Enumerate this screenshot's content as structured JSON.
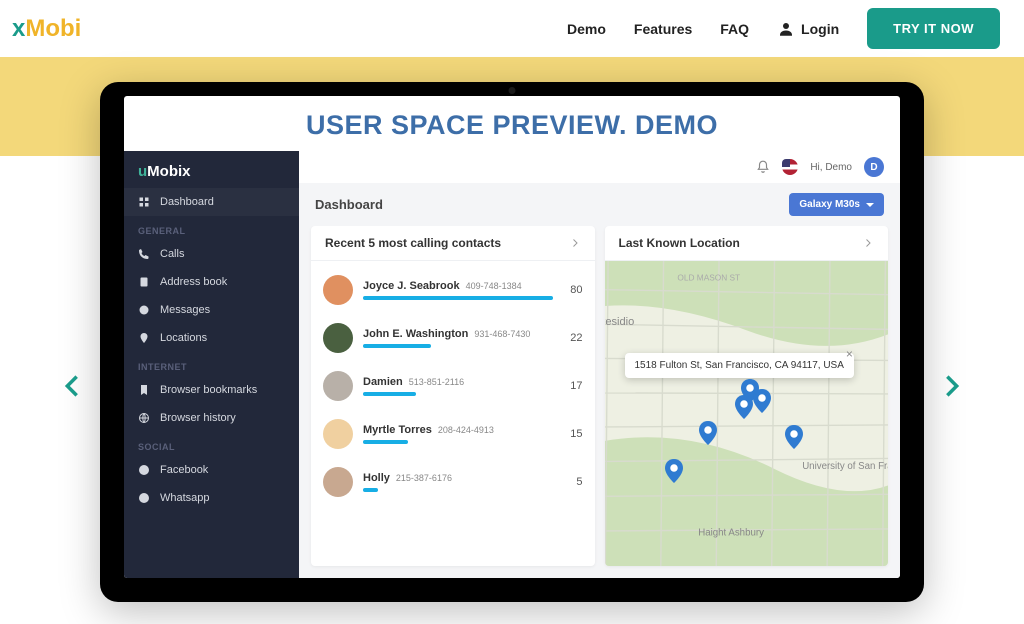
{
  "nav": {
    "logo_x": "x",
    "logo_mobi": "Mobi",
    "links": {
      "demo": "Demo",
      "features": "Features",
      "faq": "FAQ"
    },
    "login": "Login",
    "try": "TRY IT NOW"
  },
  "demo": {
    "title": "USER SPACE PREVIEW. DEMO",
    "sidebar": {
      "logo_u": "u",
      "logo_m": "Mobix",
      "items": {
        "dashboard": "Dashboard",
        "calls": "Calls",
        "address_book": "Address book",
        "messages": "Messages",
        "locations": "Locations",
        "bookmarks": "Browser bookmarks",
        "history": "Browser history",
        "facebook": "Facebook",
        "whatsapp": "Whatsapp"
      },
      "sections": {
        "general": "GENERAL",
        "internet": "INTERNET",
        "social": "SOCIAL"
      }
    },
    "header": {
      "hi": "Hi, Demo",
      "avatar_initial": "D"
    },
    "dash": {
      "label": "Dashboard",
      "device": "Galaxy M30s"
    },
    "recent_card": {
      "title": "Recent 5 most calling contacts",
      "contacts": [
        {
          "name": "Joyce J. Seabrook",
          "phone": "409-748-1384",
          "count": "80",
          "bar": 100,
          "hue": "#e09060"
        },
        {
          "name": "John E. Washington",
          "phone": "931-468-7430",
          "count": "22",
          "bar": 36,
          "hue": "#4a6040"
        },
        {
          "name": "Damien",
          "phone": "513-851-2116",
          "count": "17",
          "bar": 28,
          "hue": "#b8b0a8"
        },
        {
          "name": "Myrtle Torres",
          "phone": "208-424-4913",
          "count": "15",
          "bar": 24,
          "hue": "#f0d0a0"
        },
        {
          "name": "Holly",
          "phone": "215-387-6176",
          "count": "5",
          "bar": 8,
          "hue": "#c8a890"
        }
      ]
    },
    "location_card": {
      "title": "Last Known Location",
      "address": "1518 Fulton St, San Francisco, CA 94117, USA",
      "labels": {
        "presidio": "Presidio",
        "mason": "OLD MASON ST",
        "uni": "University of San Francisco",
        "sf": "San Fr",
        "haight": "Haight Ashbury"
      }
    }
  }
}
